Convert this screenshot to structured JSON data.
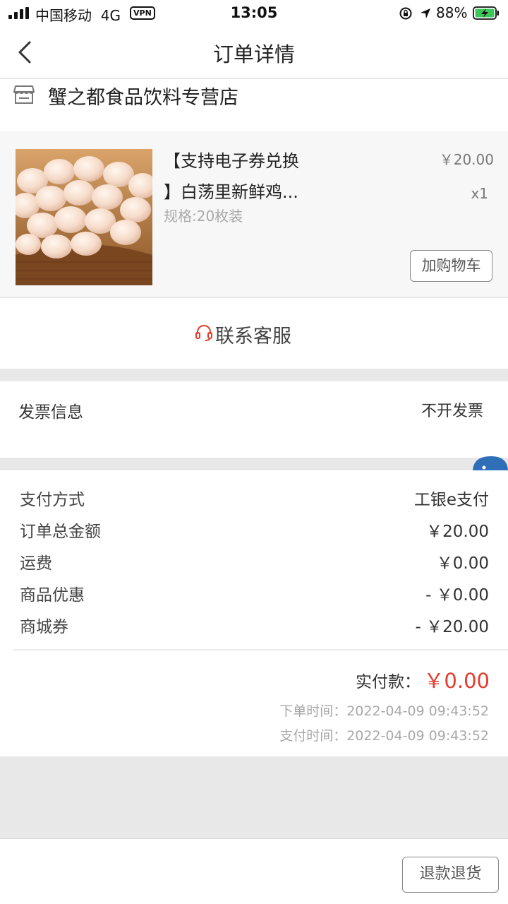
{
  "status_bar": {
    "carrier": "中国移动",
    "network": "4G",
    "vpn": "VPN",
    "time": "13:05",
    "battery_pct": "88%",
    "icons": [
      "signal-icon",
      "orientation-lock-icon",
      "location-icon",
      "battery-charging-icon"
    ]
  },
  "nav": {
    "title": "订单详情",
    "back_icon": "chevron-left-icon"
  },
  "store": {
    "name": "蟹之都食品饮料专营店",
    "icon": "store-icon"
  },
  "product": {
    "title_line1": "【支持电子券兑换",
    "title_line2": "】白荡里新鲜鸡...",
    "spec": "规格:20枚装",
    "price": "￥20.00",
    "qty": "x1",
    "add_cart_label": "加购物车"
  },
  "contact": {
    "label": "联系客服",
    "icon": "headset-icon"
  },
  "invoice": {
    "label": "发票信息",
    "value": "不开发票"
  },
  "payment": {
    "rows": [
      {
        "label": "支付方式",
        "value": "工银e支付"
      },
      {
        "label": "订单总金额",
        "value": "￥20.00"
      },
      {
        "label": "运费",
        "value": "￥0.00"
      },
      {
        "label": "商品优惠",
        "value": "- ￥0.00"
      },
      {
        "label": "商城券",
        "value": "- ￥20.00"
      }
    ],
    "paid_label": "实付款：",
    "paid_value": "￥0.00",
    "order_time": "下单时间：2022-04-09 09:43:52",
    "pay_time": "支付时间：2022-04-09 09:43:52"
  },
  "bottom": {
    "refund_label": "退款退货"
  },
  "colors": {
    "accent_red": "#e33d2f",
    "section_gap": "#e8e8e8",
    "product_bg": "#f7f7f7"
  }
}
